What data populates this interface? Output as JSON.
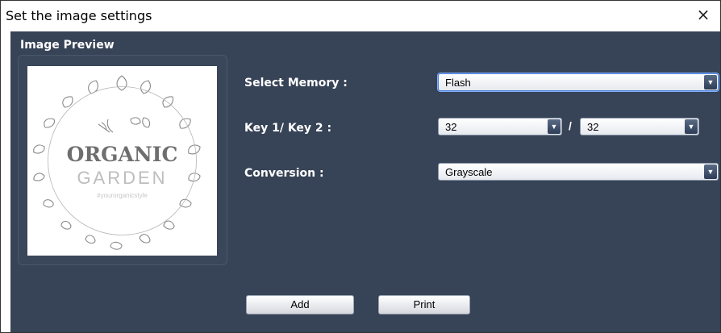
{
  "window": {
    "title": "Set the image settings",
    "close_label": "×"
  },
  "preview": {
    "label": "Image Preview",
    "logo": {
      "line1": "ORGANIC",
      "line2": "GARDEN",
      "tagline": "#yourorganicstyle"
    }
  },
  "fields": {
    "memory": {
      "label": "Select Memory :",
      "value": "Flash"
    },
    "key": {
      "label": "Key 1/ Key 2 :",
      "key1": "32",
      "separator": "/",
      "key2": "32"
    },
    "conversion": {
      "label": "Conversion :",
      "value": "Grayscale"
    }
  },
  "buttons": {
    "add": "Add",
    "print": "Print"
  },
  "colors": {
    "panel_bg": "#374356",
    "text": "#ffffff"
  },
  "icons": {
    "dropdown": "▼"
  }
}
